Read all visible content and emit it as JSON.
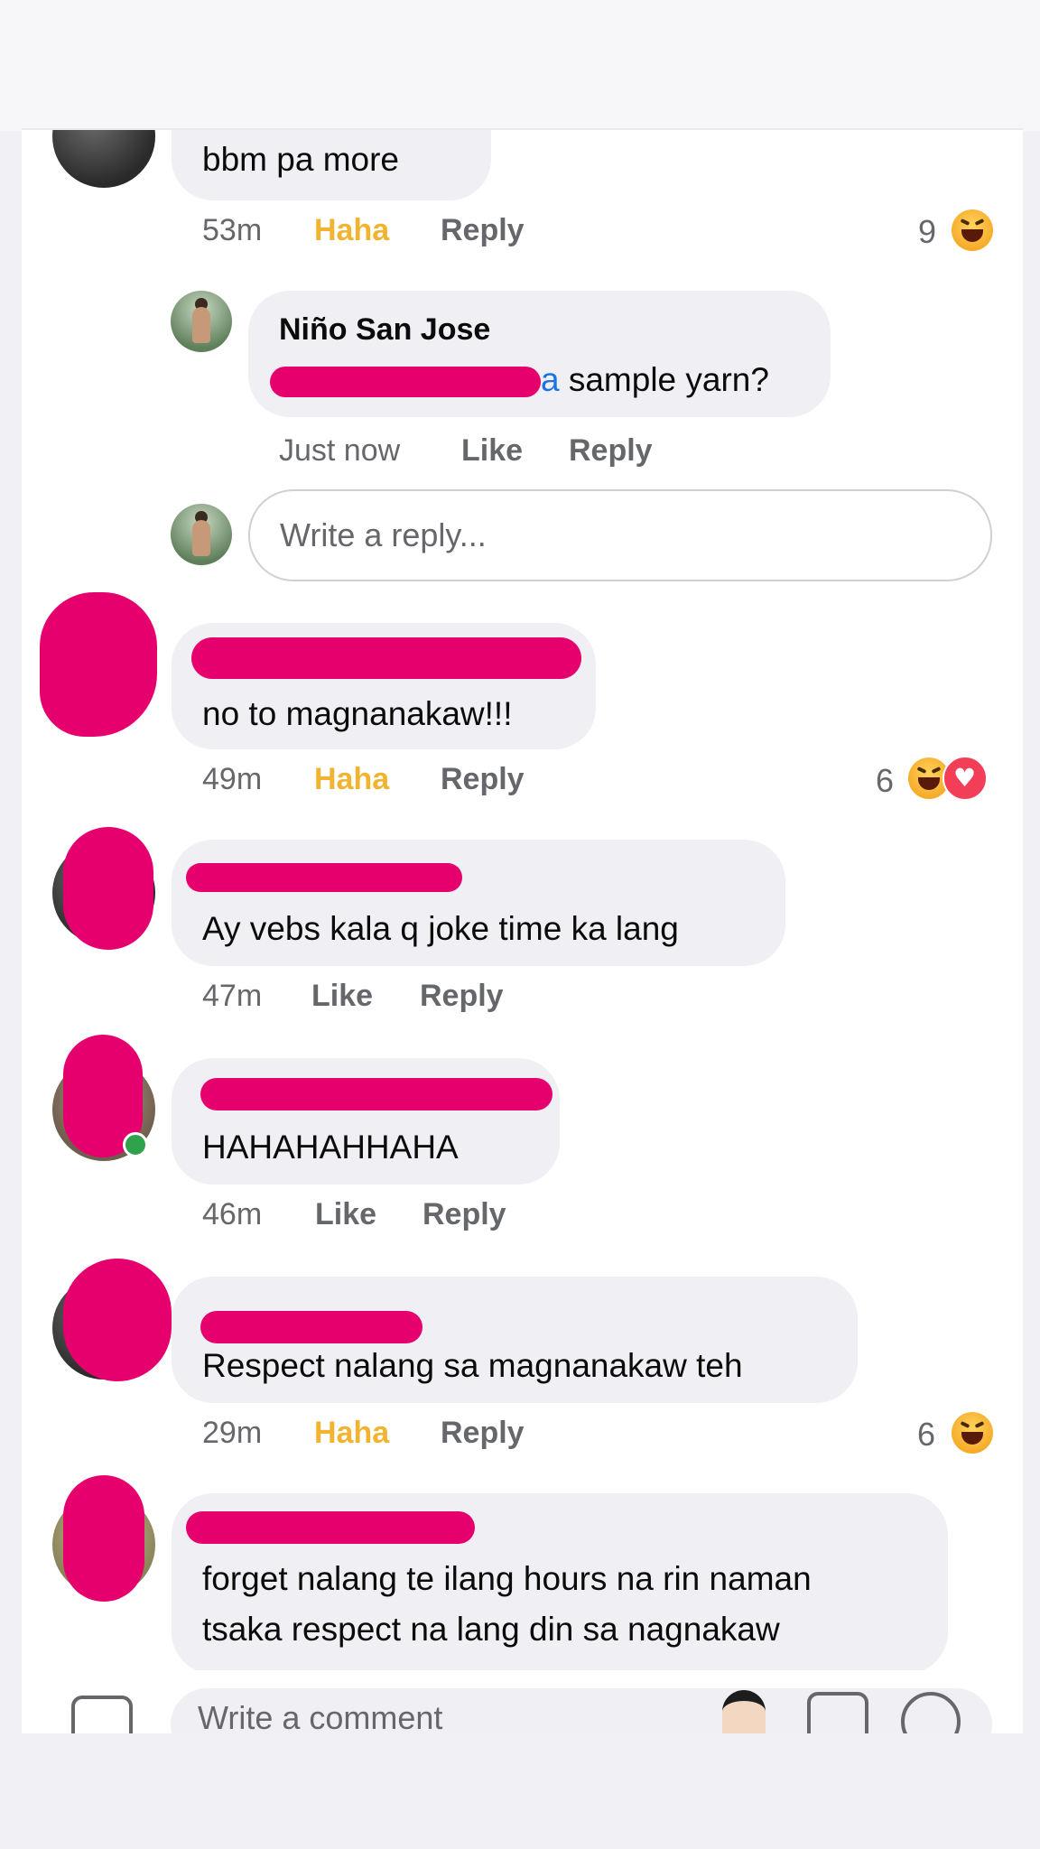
{
  "comments": [
    {
      "text": "bbm pa more",
      "time": "53m",
      "reaction_label": "Haha",
      "reply_label": "Reply",
      "reaction_count": "9",
      "reaction_icons": [
        "haha-icon"
      ]
    },
    {
      "author": "Niño San Jose",
      "mention_tail": "a",
      "text": " sample yarn?",
      "time": "Just now",
      "like_label": "Like",
      "reply_label": "Reply"
    },
    {
      "text": "no to magnanakaw!!!",
      "time": "49m",
      "reaction_label": "Haha",
      "reply_label": "Reply",
      "reaction_count": "6",
      "reaction_icons": [
        "haha-icon",
        "love-icon"
      ]
    },
    {
      "text": "Ay vebs kala q joke time ka lang",
      "time": "47m",
      "like_label": "Like",
      "reply_label": "Reply"
    },
    {
      "text": "HAHAHAHHAHA",
      "time": "46m",
      "like_label": "Like",
      "reply_label": "Reply"
    },
    {
      "text": "Respect nalang sa magnanakaw teh",
      "time": "29m",
      "reaction_label": "Haha",
      "reply_label": "Reply",
      "reaction_count": "6",
      "reaction_icons": [
        "haha-icon"
      ]
    },
    {
      "text_line1": "forget nalang te ilang hours na rin naman",
      "text_line2": "tsaka respect na lang din sa nagnakaw"
    }
  ],
  "reply_box": {
    "placeholder": "Write a reply..."
  },
  "composer": {
    "placeholder": "Write a comment",
    "icons": [
      "camera-icon",
      "avatar-sticker-icon",
      "gif-icon",
      "emoji-icon"
    ]
  },
  "colors": {
    "haha": "#f2b430",
    "mention": "#1b74e4",
    "redaction": "#e6006e",
    "online": "#31a24c"
  }
}
